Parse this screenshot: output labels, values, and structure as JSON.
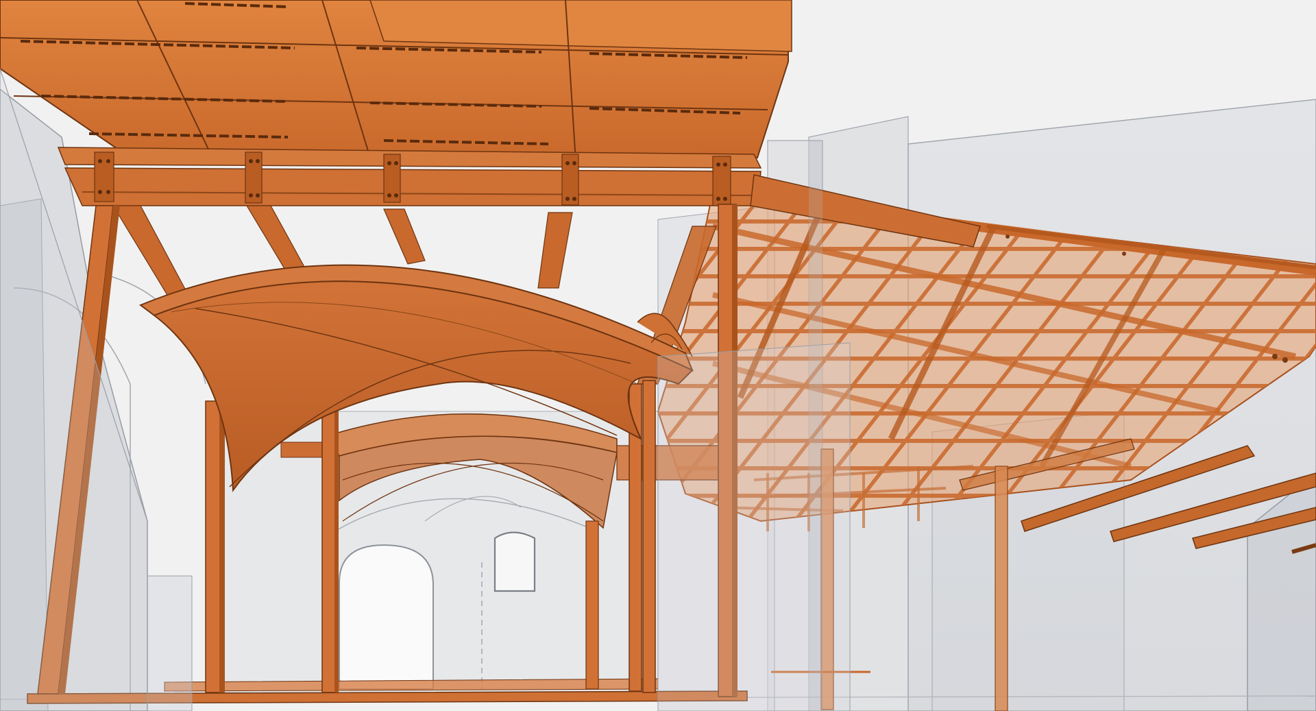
{
  "scene": {
    "kind": "3d-structural-model",
    "colors": {
      "background": "#f1f1f1",
      "steel": "#d9793a",
      "steel_dark": "#a8501c",
      "steel_light": "#e9955c",
      "steel_edge": "#6e3410",
      "ghost_fill": "#c7cbd3",
      "ghost_edge": "#8e929a",
      "opening_fill": "#fafafa"
    },
    "elements": [
      "ceiling-deck-plates",
      "main-steel-frame",
      "vaulted-canopy",
      "rear-vaulted-canopy",
      "steel-columns",
      "grid-roof-frame",
      "side-cantilever-beams",
      "translucent-existing-building",
      "arched-doorway",
      "window-opening"
    ]
  }
}
